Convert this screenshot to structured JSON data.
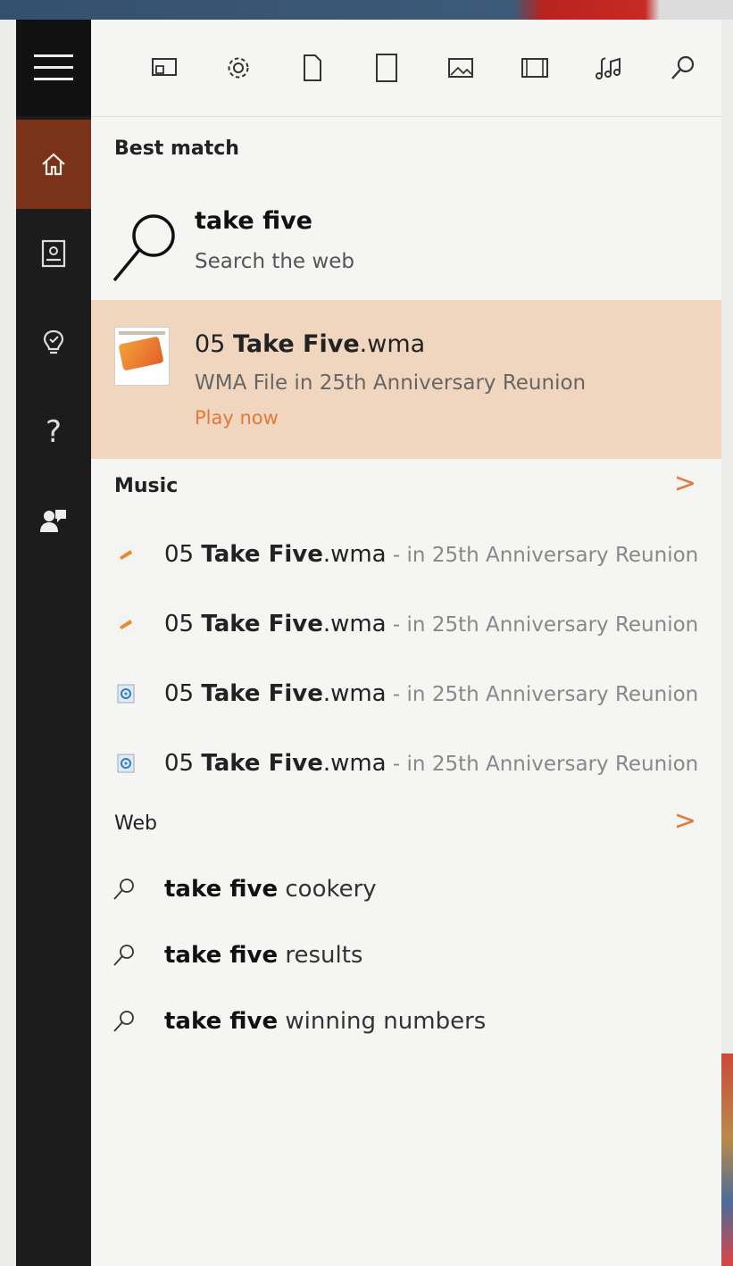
{
  "colors": {
    "accent": "#e07a3b",
    "rail_active": "#7a3318",
    "highlight": "#f0d6bf"
  },
  "rail": {
    "items": [
      {
        "name": "home",
        "icon": "home-icon"
      },
      {
        "name": "notebook",
        "icon": "notebook-icon"
      },
      {
        "name": "reminders",
        "icon": "lightbulb-icon"
      },
      {
        "name": "help",
        "icon": "question-icon",
        "glyph": "?"
      },
      {
        "name": "feedback",
        "icon": "feedback-icon"
      }
    ]
  },
  "toolbar": {
    "filters": [
      "apps-icon",
      "settings-icon",
      "documents-icon",
      "folders-icon",
      "photos-icon",
      "videos-icon",
      "music-icon",
      "search-icon"
    ]
  },
  "best_match": {
    "header": "Best match",
    "web": {
      "query": "take five",
      "subtitle": "Search the web"
    },
    "file": {
      "name_prefix": "05 ",
      "name_bold": "Take Five",
      "name_suffix": ".wma",
      "subtitle": "WMA File in 25th Anniversary Reunion",
      "action": "Play now"
    }
  },
  "music": {
    "header": "Music",
    "chevron": ">",
    "items": [
      {
        "prefix": "05 ",
        "bold": "Take Five",
        "suffix": ".wma",
        "location": " - in 25th Anniversary Reunion",
        "icon": "album-art-icon"
      },
      {
        "prefix": "05 ",
        "bold": "Take Five",
        "suffix": ".wma",
        "location": " - in 25th Anniversary Reunion",
        "icon": "album-art-icon"
      },
      {
        "prefix": "05 ",
        "bold": "Take Five",
        "suffix": ".wma",
        "location": " - in 25th Anniversary Reunion",
        "icon": "media-file-icon"
      },
      {
        "prefix": "05 ",
        "bold": "Take Five",
        "suffix": ".wma",
        "location": " - in 25th Anniversary Reunion",
        "icon": "media-file-icon"
      }
    ]
  },
  "web": {
    "header": "Web",
    "chevron": ">",
    "items": [
      {
        "bold": "take five",
        "rest": " cookery"
      },
      {
        "bold": "take five",
        "rest": " results"
      },
      {
        "bold": "take five",
        "rest": " winning numbers"
      }
    ]
  }
}
